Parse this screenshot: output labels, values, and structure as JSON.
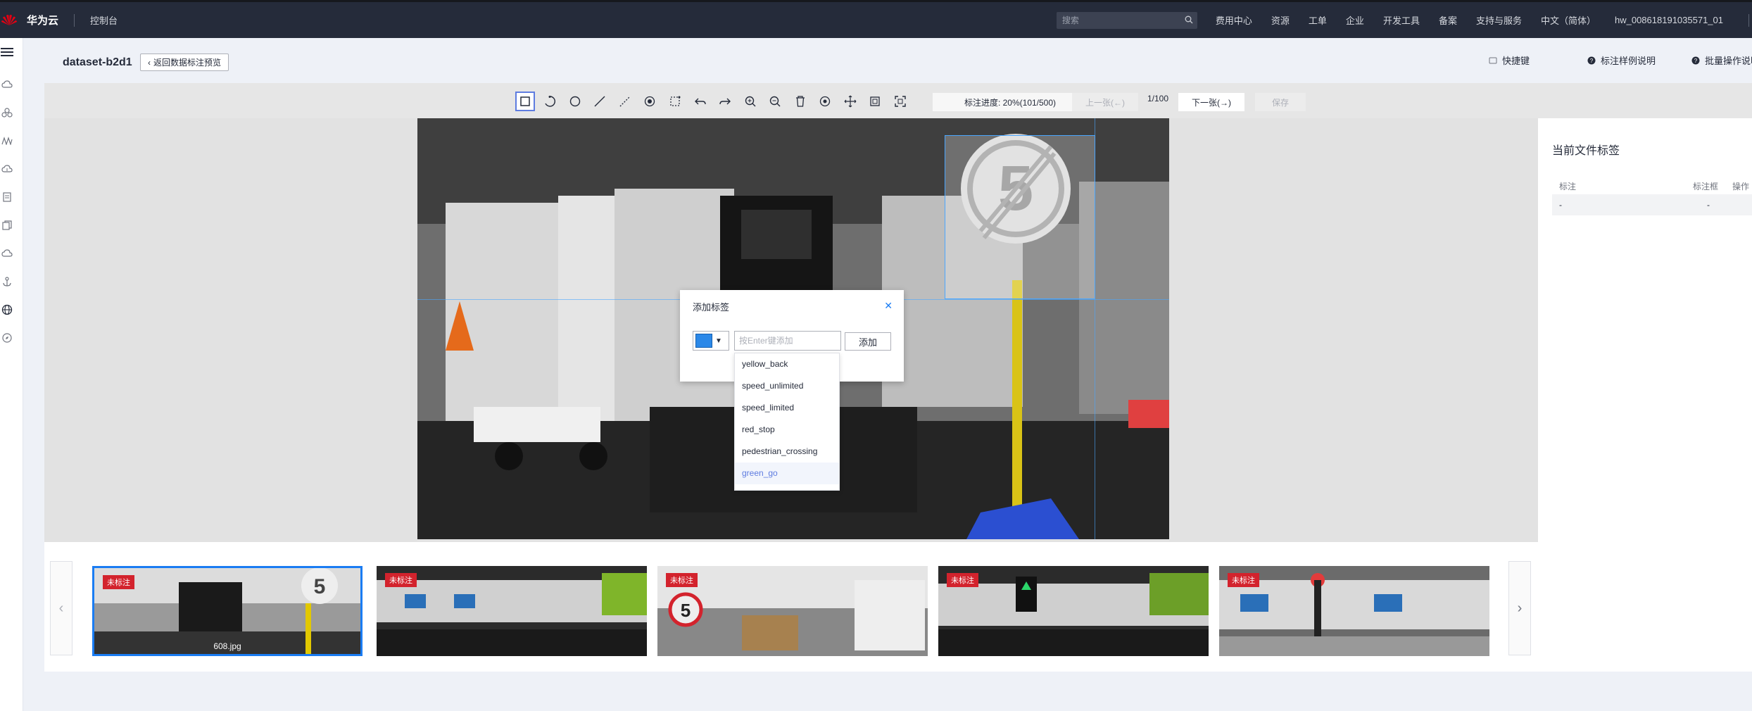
{
  "topnav": {
    "brand": "华为云",
    "console": "控制台",
    "search_placeholder": "搜索",
    "links": [
      "费用中心",
      "资源",
      "工单",
      "企业",
      "开发工具",
      "备案",
      "支持与服务",
      "中文（简体）"
    ],
    "user": "hw_008618191035571_01"
  },
  "header": {
    "dataset_name": "dataset-b2d1",
    "back_label": "返回数据标注预览",
    "shortcut_label": "快捷键",
    "sample_label": "标注样例说明",
    "batch_label": "批量操作说明"
  },
  "toolbar": {
    "progress": "标注进度: 20%(101/500)",
    "prev_label": "上一张(←)",
    "counter": "1/100",
    "next_label": "下一张(→)",
    "save_label": "保存",
    "tools": [
      "rectangle",
      "polygon",
      "circle",
      "line",
      "dashed-line",
      "point",
      "rotated-box",
      "undo",
      "redo",
      "zoom-in",
      "zoom-out",
      "delete",
      "target",
      "move",
      "fit",
      "fullscreen"
    ]
  },
  "dialog": {
    "title": "添加标签",
    "input_placeholder": "按Enter键添加",
    "add_label": "添加",
    "color": "#2b88e8",
    "options": [
      "yellow_back",
      "speed_unlimited",
      "speed_limited",
      "red_stop",
      "pedestrian_crossing",
      "green_go"
    ],
    "hovered_option": "green_go"
  },
  "right_panel": {
    "title": "当前文件标签",
    "columns": [
      "标注",
      "标注框",
      "操作"
    ],
    "row": [
      "-",
      "-",
      ""
    ]
  },
  "filmstrip": {
    "thumbnails": [
      {
        "badge": "未标注",
        "name": "608.jpg",
        "selected": true
      },
      {
        "badge": "未标注",
        "name": "",
        "selected": false
      },
      {
        "badge": "未标注",
        "name": "",
        "selected": false
      },
      {
        "badge": "未标注",
        "name": "",
        "selected": false
      },
      {
        "badge": "未标注",
        "name": "",
        "selected": false
      }
    ]
  },
  "colors": {
    "nav_bg": "#252b3a",
    "accent": "#1a7cf3",
    "badge_red": "#d3232d",
    "bbox_blue": "#4aa6ff"
  }
}
